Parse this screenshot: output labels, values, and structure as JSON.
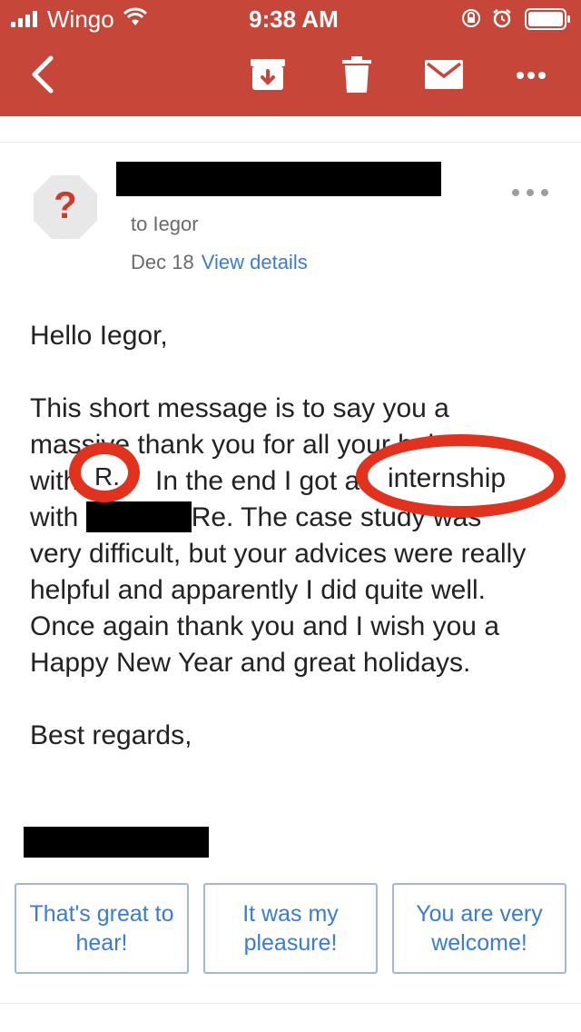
{
  "status_bar": {
    "carrier": "Wingo",
    "time": "9:38 AM"
  },
  "toolbar": {
    "icons": [
      "back-arrow-icon",
      "archive-icon",
      "trash-icon",
      "mail-icon",
      "more-icon"
    ]
  },
  "message": {
    "avatar_symbol": "?",
    "to_line": "to Iegor",
    "date": "Dec 18",
    "view_details": "View details",
    "greeting": "Hello Iegor,",
    "body_line1": "This short message is to say you a",
    "body_line2": "massive thank you for all your help",
    "body_line3_a": "with",
    "body_line3_b": "In the end I got an internship",
    "body_line4_a": "with",
    "body_line4_b": "Re. The case study was",
    "body_rest": "very difficult, but your advices were really helpful and apparently I did quite well.",
    "closing_para": "Once again thank you and I wish you a Happy New Year and great holidays.",
    "sign_off": "Best regards,"
  },
  "annotations": {
    "circle1_text": "R.",
    "circle2_text": "internship",
    "color": "#e2311d"
  },
  "smart_replies": [
    {
      "label": "That's great to hear!"
    },
    {
      "label": "It was my pleasure!"
    },
    {
      "label": "You are very welcome!"
    }
  ],
  "colors": {
    "header": "#c6473a",
    "link": "#3b7bd1"
  }
}
